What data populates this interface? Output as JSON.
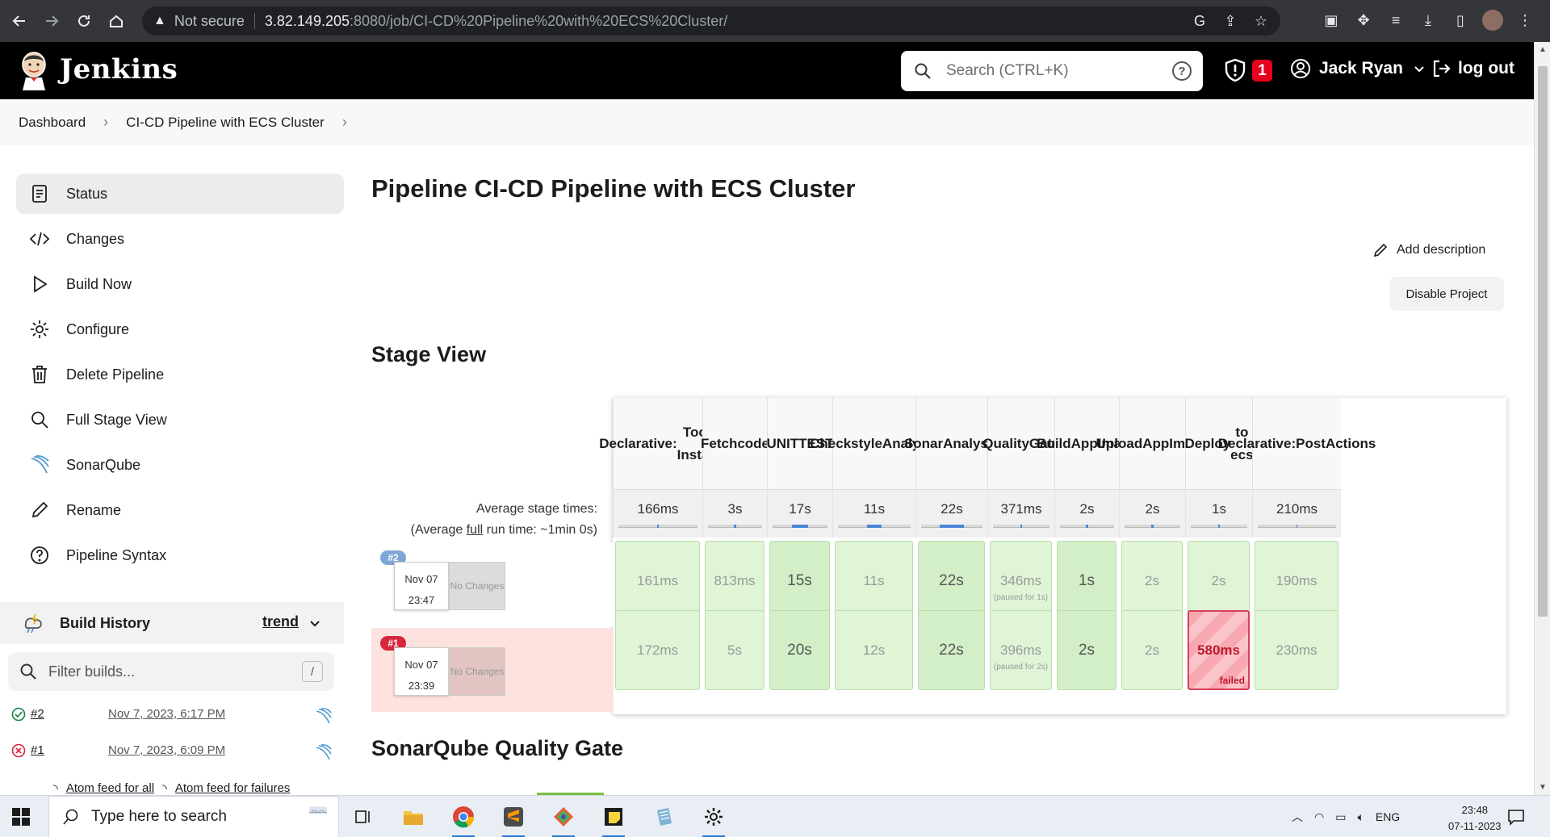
{
  "browser": {
    "security_label": "Not secure",
    "url_host": "3.82.149.205",
    "url_path": ":8080/job/CI-CD%20Pipeline%20with%20ECS%20Cluster/"
  },
  "header": {
    "brand": "Jenkins",
    "search_placeholder": "Search (CTRL+K)",
    "security_badge_count": "1",
    "user_name": "Jack Ryan",
    "logout_label": "log out"
  },
  "breadcrumb": [
    "Dashboard",
    "CI-CD Pipeline with ECS Cluster"
  ],
  "sidebar": {
    "items": [
      {
        "label": "Status",
        "icon": "status-icon"
      },
      {
        "label": "Changes",
        "icon": "code-icon"
      },
      {
        "label": "Build Now",
        "icon": "play-icon"
      },
      {
        "label": "Configure",
        "icon": "gear-icon"
      },
      {
        "label": "Delete Pipeline",
        "icon": "trash-icon"
      },
      {
        "label": "Full Stage View",
        "icon": "search-icon"
      },
      {
        "label": "SonarQube",
        "icon": "sonarqube-icon"
      },
      {
        "label": "Rename",
        "icon": "pencil-icon"
      },
      {
        "label": "Pipeline Syntax",
        "icon": "help-icon"
      }
    ]
  },
  "build_history": {
    "title": "Build History",
    "trend_label": "trend",
    "filter_placeholder": "Filter builds...",
    "filter_shortcut": "/",
    "builds": [
      {
        "number": "#2",
        "date": "Nov 7, 2023, 6:17 PM",
        "status": "success"
      },
      {
        "number": "#1",
        "date": "Nov 7, 2023, 6:09 PM",
        "status": "failed"
      }
    ],
    "feed_all": "Atom feed for all",
    "feed_failures": "Atom feed for failures"
  },
  "main": {
    "title": "Pipeline CI-CD Pipeline with ECS Cluster",
    "add_description": "Add description",
    "disable_project": "Disable Project",
    "stage_view_title": "Stage View",
    "sonarqube_title": "SonarQube Quality Gate",
    "avg_stage_times_label": "Average stage times:",
    "avg_full_prefix": "(Average ",
    "avg_full_word": "full",
    "avg_full_suffix": " run time: ~1min 0s)"
  },
  "stage_view": {
    "stages": [
      {
        "name": [
          "Declarative:",
          "Tool Install"
        ],
        "avg": "166ms",
        "avg_fill": 0.02
      },
      {
        "name": [
          "Fetch",
          "code"
        ],
        "avg": "3s",
        "avg_fill": 0.05
      },
      {
        "name": [
          "UNIT",
          "TEST"
        ],
        "avg": "17s",
        "avg_fill": 0.3
      },
      {
        "name": [
          "Checkstyle",
          "Analysis"
        ],
        "avg": "11s",
        "avg_fill": 0.2
      },
      {
        "name": [
          "Sonar",
          "Analysis"
        ],
        "avg": "22s",
        "avg_fill": 0.4
      },
      {
        "name": [
          "Quality",
          "Gate"
        ],
        "avg": "371ms",
        "avg_fill": 0.02
      },
      {
        "name": [
          "Build",
          "App",
          "Image"
        ],
        "avg": "2s",
        "avg_fill": 0.04
      },
      {
        "name": [
          "Upload",
          "App",
          "Image"
        ],
        "avg": "2s",
        "avg_fill": 0.04
      },
      {
        "name": [
          "Deploy",
          "to ecs"
        ],
        "avg": "1s",
        "avg_fill": 0.02
      },
      {
        "name": [
          "Declarative:",
          "Post",
          "Actions"
        ],
        "avg": "210ms",
        "avg_fill": 0.02
      }
    ],
    "runs": [
      {
        "badge": "#2",
        "month_day": "Nov 07",
        "time": "23:47",
        "changes": "No Changes",
        "state": "success",
        "cells": [
          {
            "value": "161ms"
          },
          {
            "value": "813ms"
          },
          {
            "value": "15s",
            "dark": true
          },
          {
            "value": "11s"
          },
          {
            "value": "22s",
            "dark": true
          },
          {
            "value": "346ms",
            "note": "(paused for 1s)"
          },
          {
            "value": "1s",
            "dark": true
          },
          {
            "value": "2s"
          },
          {
            "value": "2s"
          },
          {
            "value": "190ms"
          }
        ]
      },
      {
        "badge": "#1",
        "month_day": "Nov 07",
        "time": "23:39",
        "changes": "No Changes",
        "state": "failed",
        "cells": [
          {
            "value": "172ms"
          },
          {
            "value": "5s"
          },
          {
            "value": "20s",
            "dark": true
          },
          {
            "value": "12s"
          },
          {
            "value": "22s",
            "dark": true
          },
          {
            "value": "396ms",
            "note": "(paused for 2s)"
          },
          {
            "value": "2s",
            "dark": true
          },
          {
            "value": "2s"
          },
          {
            "value": "580ms",
            "failed": true,
            "fail_label": "failed"
          },
          {
            "value": "230ms"
          }
        ]
      }
    ]
  },
  "taskbar": {
    "search_placeholder": "Type here to search",
    "language": "ENG",
    "time": "23:48",
    "date": "07-11-2023"
  }
}
